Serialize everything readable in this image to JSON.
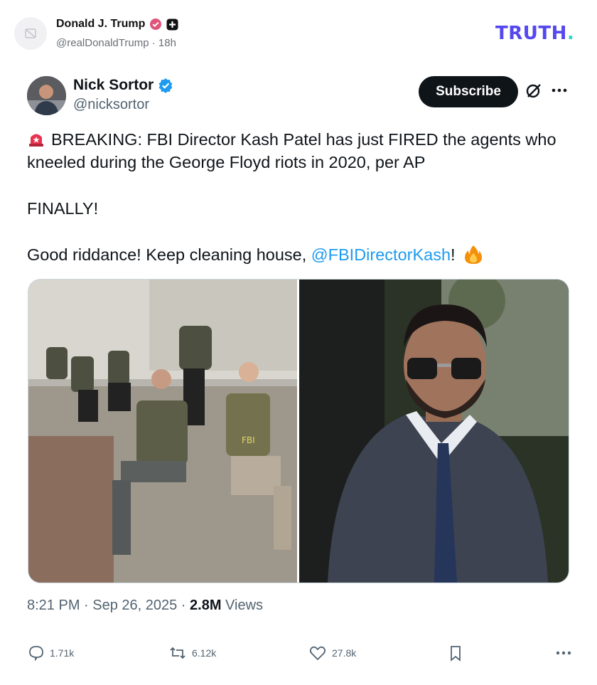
{
  "truth_post": {
    "author_name": "Donald J. Trump",
    "author_handle": "@realDonaldTrump",
    "time_ago": "18h",
    "logo_text": "TRUTH",
    "logo_dot": ".",
    "brand_color": "#5448ee",
    "accent_color": "#2fd5c9"
  },
  "embedded_tweet": {
    "author_name": "Nick Sortor",
    "author_handle": "@nicksortor",
    "subscribe_label": "Subscribe",
    "icons": [
      "grok-icon",
      "more-icon",
      "verified-badge-icon",
      "siren-icon",
      "fire-icon"
    ],
    "text_line1": "BREAKING: FBI Director Kash Patel has just FIRED the agents who kneeled during the George Floyd riots in 2020, per AP",
    "text_line2": "FINALLY!",
    "text_line3_prefix": "Good riddance! Keep cleaning house, ",
    "mention": "@FBIDirectorKash",
    "text_line3_suffix": "!",
    "timestamp": "8:21 PM · Sep 26, 2025 · ",
    "views_count": "2.8M",
    "views_label": " Views",
    "link_color": "#1d9bf0"
  },
  "actions": {
    "replies": "1.71k",
    "retweets": "6.12k",
    "likes": "27.8k"
  }
}
